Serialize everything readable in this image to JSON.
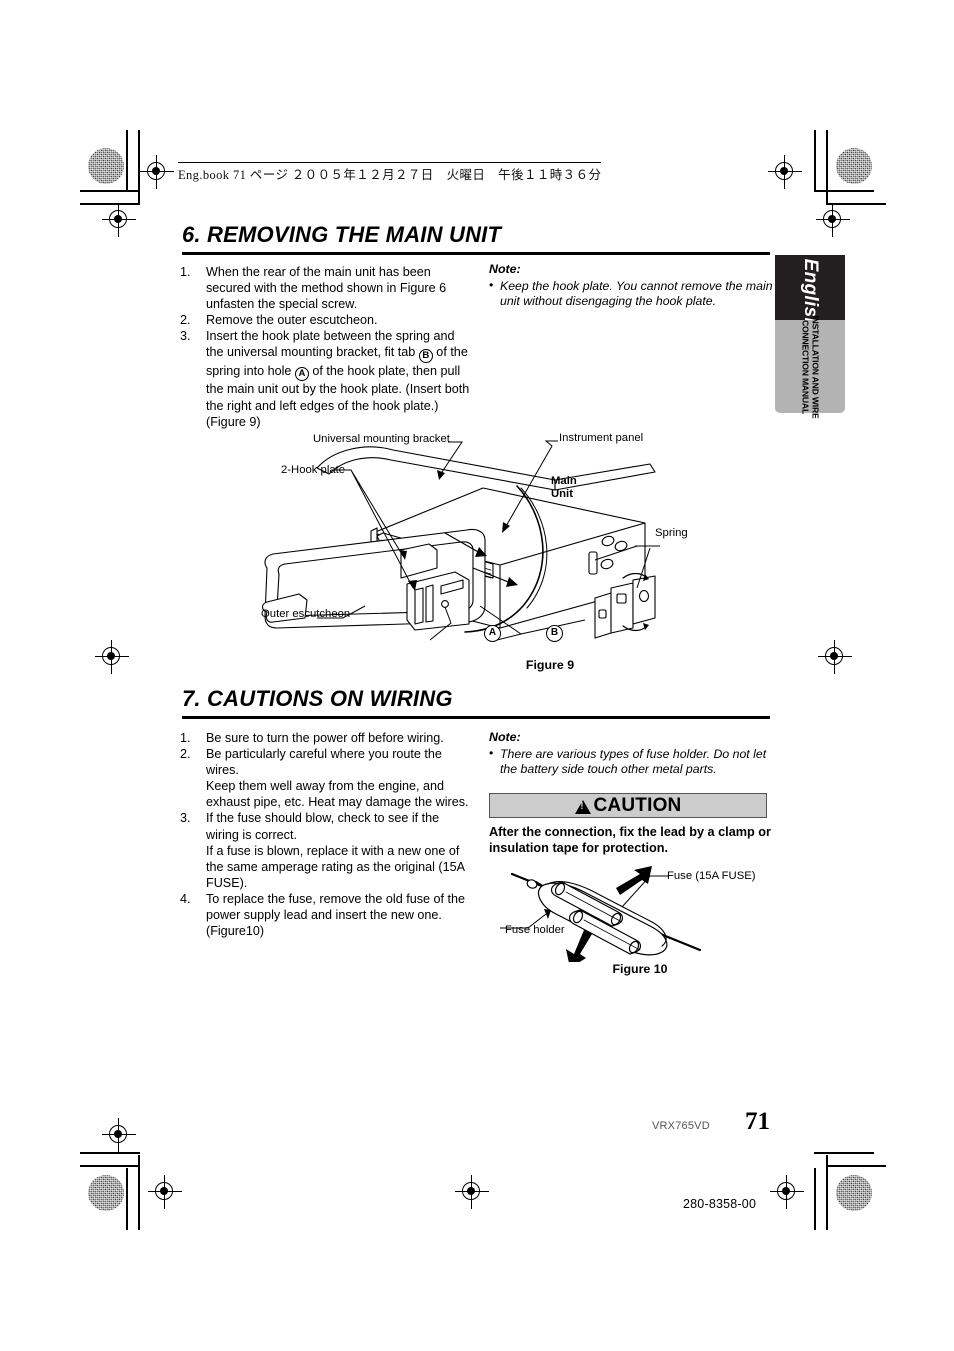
{
  "header": {
    "running_head": "Eng.book  71 ページ  ２００５年１２月２７日　火曜日　午後１１時３６分"
  },
  "side_tab": {
    "language": "English",
    "manual_type": "INSTALLATION AND WIRE\nCONNECTION MANUAL",
    "manual_line1": "INSTALLATION AND WIRE",
    "manual_line2": "CONNECTION MANUAL",
    "black_color": "#231f20",
    "gray_color": "#b3b3b3"
  },
  "section6": {
    "heading": "6. REMOVING THE MAIN UNIT",
    "steps": [
      {
        "num": "1.",
        "text": "When the rear of the main unit has been secured with the method shown in Figure 6 unfasten the special screw."
      },
      {
        "num": "2.",
        "text": "Remove the outer escutcheon."
      },
      {
        "num": "3.",
        "text_part1": "Insert the hook plate between the spring and the universal mounting bracket, fit tab ",
        "tab_b": "B",
        "text_part2": " of the spring into hole ",
        "tab_a": "A",
        "text_part3": " of the hook plate, then pull the main unit out by the hook plate. (Insert both the right and left edges of the hook plate.) (Figure 9)"
      }
    ],
    "note": {
      "title": "Note:",
      "bullet": "•",
      "text": "Keep the hook plate. You cannot remove the main unit without disengaging the hook plate."
    }
  },
  "figure9": {
    "caption": "Figure 9",
    "labels": {
      "universal_mounting_bracket": "Universal mounting bracket",
      "instrument_panel": "Instrument panel",
      "hook_plate": "2-Hook plate",
      "main_unit_line1": "Main",
      "main_unit_line2": "Unit",
      "spring": "Spring",
      "outer_escutcheon": "Outer escutcheon",
      "marker_a": "A",
      "marker_b": "B"
    }
  },
  "section7": {
    "heading": "7. CAUTIONS ON WIRING",
    "steps": [
      {
        "num": "1.",
        "text": "Be sure to turn the power off before wiring."
      },
      {
        "num": "2.",
        "text": "Be particularly careful where you route the wires.\nKeep them well away from the engine, and exhaust pipe, etc. Heat may damage the wires."
      },
      {
        "num": "3.",
        "text": "If the fuse should blow, check to see if the wiring is correct.\nIf a fuse is blown, replace it with a new one of the same amperage rating as the original (15A FUSE)."
      },
      {
        "num": "4.",
        "text": "To replace the fuse, remove the old fuse of the power supply lead and insert the new one. (Figure10)"
      }
    ],
    "note": {
      "title": "Note:",
      "bullet": "•",
      "text": "There are various types of fuse holder. Do not let the battery side touch other metal parts."
    },
    "caution": {
      "label": "CAUTION",
      "warning_symbol": "warning-triangle-icon",
      "text": "After the connection, fix the lead by a clamp or insulation tape for protection.",
      "box_bg": "#cccccc"
    }
  },
  "figure10": {
    "caption": "Figure 10",
    "labels": {
      "fuse": "Fuse (15A FUSE)",
      "fuse_holder": "Fuse holder"
    }
  },
  "footer": {
    "model_code": "VRX765VD",
    "page_number": "71",
    "document_code": "280-8358-00"
  }
}
